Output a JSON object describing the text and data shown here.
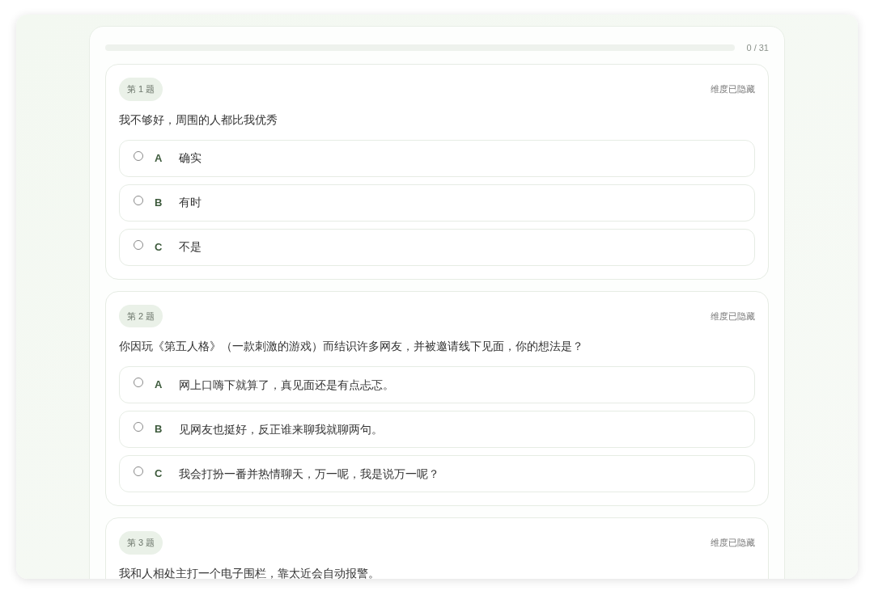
{
  "progress": {
    "level": 0,
    "text": "0 / 31"
  },
  "questions": [
    {
      "badge": "第 1 题",
      "dimension": "维度已隐藏",
      "text": "我不够好，周围的人都比我优秀",
      "options": [
        {
          "letter": "A",
          "text": "确实",
          "selected": false
        },
        {
          "letter": "B",
          "text": "有时",
          "selected": false
        },
        {
          "letter": "C",
          "text": "不是",
          "selected": false
        }
      ]
    },
    {
      "badge": "第 2 题",
      "dimension": "维度已隐藏",
      "text": "你因玩《第五人格》（一款刺激的游戏）而结识许多网友，并被邀请线下见面，你的想法是？",
      "options": [
        {
          "letter": "A",
          "text": "网上口嗨下就算了，真见面还是有点忐忑。",
          "selected": false
        },
        {
          "letter": "B",
          "text": "见网友也挺好，反正谁来聊我就聊两句。",
          "selected": false
        },
        {
          "letter": "C",
          "text": "我会打扮一番并热情聊天，万一呢，我是说万一呢？",
          "selected": false
        }
      ]
    },
    {
      "badge": "第 3 题",
      "dimension": "维度已隐藏",
      "text": "我和人相处主打一个电子围栏，靠太近会自动报警。"
    }
  ]
}
